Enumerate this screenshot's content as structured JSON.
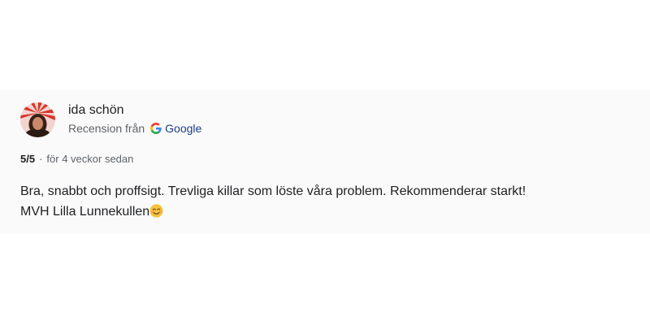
{
  "review": {
    "author_name": "ida schön",
    "source_prefix": "Recension från",
    "source_brand": "Google",
    "source_icon": "google-g-icon",
    "rating": "5/5",
    "separator": "·",
    "time_ago": "för 4 veckor sedan",
    "text_line1": "Bra, snabbt och proffsigt. Trevliga killar som löste våra problem. Rekommenderar starkt!",
    "text_line2": "MVH Lilla Lunnekullen",
    "emoji": "smiling-face-emoji"
  },
  "colors": {
    "card_background": "#fafafa",
    "text_primary": "#202124",
    "text_secondary": "#5f6368",
    "brand_link": "#1a3f8a"
  }
}
